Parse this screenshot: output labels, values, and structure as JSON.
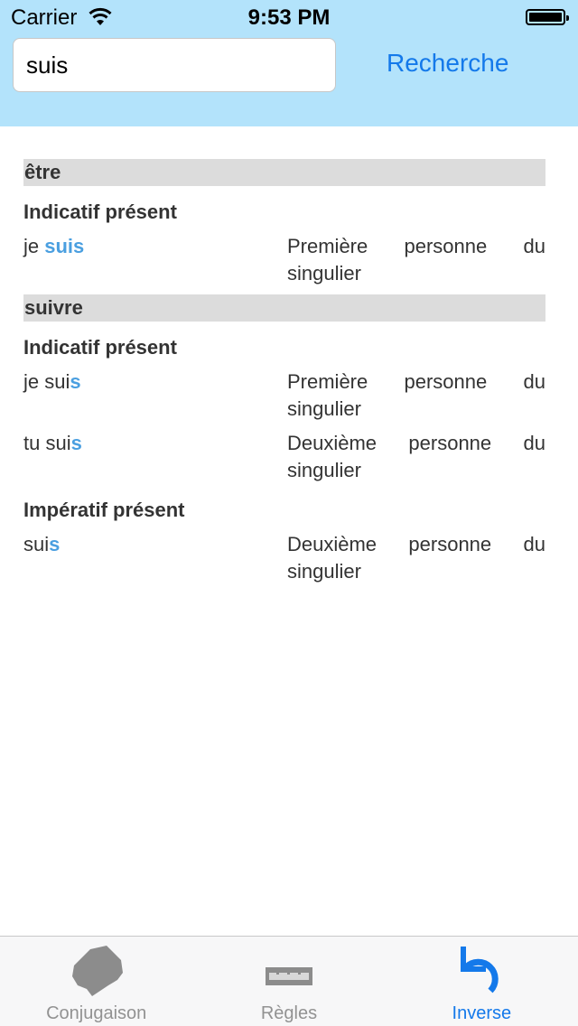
{
  "status_bar": {
    "carrier": "Carrier",
    "time": "9:53 PM"
  },
  "search": {
    "value": "suis",
    "button_label": "Recherche"
  },
  "results": [
    {
      "verb": "être",
      "tenses": [
        {
          "name": "Indicatif présent",
          "forms": [
            {
              "pre": "je ",
              "stem": "",
              "hl": "suis",
              "desc1": [
                "Première",
                "personne",
                "du"
              ],
              "desc2": "singulier"
            }
          ]
        }
      ]
    },
    {
      "verb": "suivre",
      "tenses": [
        {
          "name": "Indicatif présent",
          "forms": [
            {
              "pre": "je ",
              "stem": "sui",
              "hl": "s",
              "desc1": [
                "Première",
                "personne",
                "du"
              ],
              "desc2": "singulier"
            },
            {
              "pre": "tu ",
              "stem": "sui",
              "hl": "s",
              "desc1": [
                "Deuxième",
                "personne",
                "du"
              ],
              "desc2": "singulier"
            }
          ]
        },
        {
          "name": "Impératif présent",
          "forms": [
            {
              "pre": "",
              "stem": "sui",
              "hl": "s",
              "desc1": [
                "Deuxième",
                "personne",
                "du"
              ],
              "desc2": "singulier"
            }
          ]
        }
      ]
    }
  ],
  "tabs": [
    {
      "label": "Conjugaison",
      "icon": "map-icon",
      "active": false
    },
    {
      "label": "Règles",
      "icon": "ruler-icon",
      "active": false
    },
    {
      "label": "Inverse",
      "icon": "undo-arrow-icon",
      "active": true
    }
  ],
  "colors": {
    "header_bg": "#b3e3fb",
    "accent": "#1479ea",
    "highlight": "#4a9fe0",
    "verb_bar": "#dcdcdc"
  }
}
